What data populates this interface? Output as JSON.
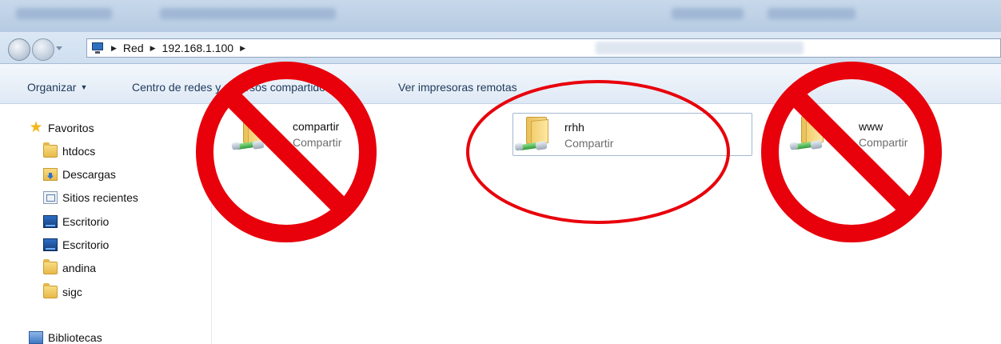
{
  "address_bar": {
    "breadcrumbs": [
      "Red",
      "192.168.1.100"
    ]
  },
  "toolbar": {
    "organize_label": "Organizar",
    "network_center_label": "Centro de redes y recursos compartidos",
    "remote_printers_label": "Ver impresoras remotas"
  },
  "nav": {
    "favorites_label": "Favoritos",
    "items": [
      {
        "label": "htdocs",
        "icon": "folder-icon"
      },
      {
        "label": "Descargas",
        "icon": "downloads-icon"
      },
      {
        "label": "Sitios recientes",
        "icon": "recent-places-icon"
      },
      {
        "label": "Escritorio",
        "icon": "desktop-icon"
      },
      {
        "label": "Escritorio",
        "icon": "desktop-icon"
      },
      {
        "label": "andina",
        "icon": "folder-icon"
      },
      {
        "label": "sigc",
        "icon": "folder-icon"
      }
    ],
    "libraries_label": "Bibliotecas"
  },
  "shares": [
    {
      "name": "compartir",
      "type": "Compartir",
      "marked": "prohibited"
    },
    {
      "name": "rrhh",
      "type": "Compartir",
      "marked": "circled"
    },
    {
      "name": "www",
      "type": "Compartir",
      "marked": "prohibited"
    }
  ],
  "colors": {
    "annotation_red": "#e8000b",
    "toolbar_text": "#1e395b",
    "selection_border": "#a4b8d3"
  }
}
